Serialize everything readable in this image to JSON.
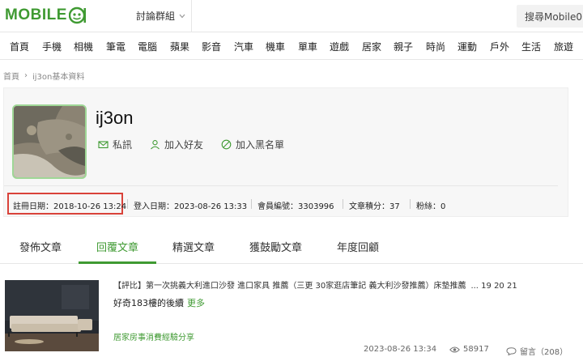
{
  "header": {
    "logo_text": "MOBILE",
    "logo_mark": "01",
    "forum_menu_label": "討論群組",
    "search_label": "搜尋Mobile01"
  },
  "nav": {
    "items": [
      "首頁",
      "手機",
      "相機",
      "筆電",
      "電腦",
      "蘋果",
      "影音",
      "汽車",
      "機車",
      "單車",
      "遊戲",
      "居家",
      "親子",
      "時尚",
      "運動",
      "戶外",
      "生活",
      "旅遊"
    ]
  },
  "breadcrumb": {
    "home": "首頁",
    "separator": "›",
    "current": "ij3on基本資料"
  },
  "profile": {
    "username": "ij3on",
    "actions": {
      "message": "私訊",
      "add_friend": "加入好友",
      "block": "加入黑名單"
    },
    "stats": {
      "registered": "註冊日期：2018-10-26 13:24",
      "last_login": "登入日期：2023-08-26 13:33",
      "member_id": "會員編號：3303996",
      "post_points": "文章積分：37",
      "fans": "粉絲：0"
    }
  },
  "tabs": [
    "發佈文章",
    "回覆文章",
    "精選文章",
    "獲鼓勵文章",
    "年度回顧"
  ],
  "active_tab": 1,
  "post": {
    "title": "【評比】第一次挑義大利進口沙發 進口家具 推薦（三更 30家逛店筆記 義大利沙發推薦）床墊推薦",
    "pages": "... 19  20  21",
    "excerpt": "好奇183樓的後續",
    "more_label": "更多",
    "category": "居家房事消費經驗分享",
    "datetime": "2023-08-26 13:34",
    "views": "58917",
    "comments": "留言（208）"
  },
  "colors": {
    "brand": "#3f9a32",
    "highlight": "#d9423a"
  }
}
